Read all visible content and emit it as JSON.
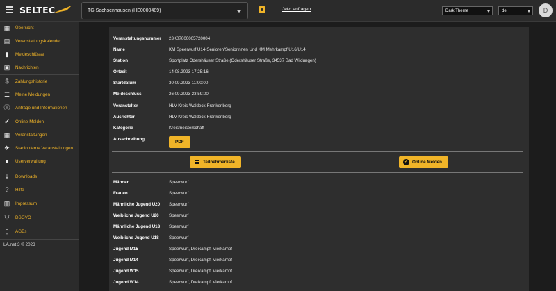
{
  "header": {
    "logo_text": "SELTEC",
    "club_select_value": "TG Sachsenhausen (HE0000489)",
    "ask_link": "Jetzt anfragen",
    "theme_value": "Dark Theme",
    "lang_value": "de",
    "avatar_initial": "D"
  },
  "colors": {
    "accent": "#f0b428",
    "background": "#1c1c1c",
    "panel": "#2e2e2e",
    "sidebar": "#2b2b2b"
  },
  "sidebar": {
    "items": [
      {
        "label": "Übersicht",
        "icon": "dashboard-icon"
      },
      {
        "label": "Veranstaltungskalender",
        "icon": "calendar-icon"
      },
      {
        "label": "Meldeschlüsse",
        "icon": "alert-icon"
      },
      {
        "label": "Nachrichten",
        "icon": "news-icon"
      },
      {
        "label": "Zahlungshistorie",
        "icon": "dollar-icon"
      },
      {
        "label": "Meine Meldungen",
        "icon": "list-icon"
      },
      {
        "label": "Anträge und Informationen",
        "icon": "info-icon"
      },
      {
        "label": "Online-Melden",
        "icon": "check-circle-icon"
      },
      {
        "label": "Veranstaltungen",
        "icon": "event-icon"
      },
      {
        "label": "Stadionferne Veranstaltungen",
        "icon": "runner-icon"
      },
      {
        "label": "Userverwaltung",
        "icon": "user-icon"
      },
      {
        "label": "Downloads",
        "icon": "download-icon"
      },
      {
        "label": "Hilfe",
        "icon": "help-icon"
      },
      {
        "label": "Impressum",
        "icon": "building-icon"
      },
      {
        "label": "DSGVO",
        "icon": "shield-icon"
      },
      {
        "label": "AGBs",
        "icon": "book-icon"
      }
    ],
    "footer": "LA.net 3 © 2023"
  },
  "details": [
    {
      "key": "Veranstaltungsnummer",
      "value": "23K07000005720004"
    },
    {
      "key": "Name",
      "value": "KM Speerwurf U14-Senioren/Seniorinnen Und KM Mehrkampf U16/U14"
    },
    {
      "key": "Station",
      "value": "Sportplatz Odershäuser Straße (Odershäuser Straße, 34537 Bad Wildungen)"
    },
    {
      "key": "Ortzeit",
      "value": "14.08.2023 17:25:16"
    },
    {
      "key": "Startdatum",
      "value": "30.09.2023 11:00:00"
    },
    {
      "key": "Meldeschluss",
      "value": "26.09.2023 23:59:00"
    },
    {
      "key": "Veranstalter",
      "value": "HLV-Kreis Waldeck-Frankenberg"
    },
    {
      "key": "Ausrichter",
      "value": "HLV-Kreis Waldeck-Frankenberg"
    },
    {
      "key": "Kategorie",
      "value": "Kreismeisterschaft"
    },
    {
      "key": "Ausschreibung",
      "value": ""
    }
  ],
  "pdf_button": "PDF",
  "buttons": {
    "participants": "Teilnehmerliste",
    "online_register": "Online Melden"
  },
  "disciplines": [
    {
      "key": "Männer",
      "value": "Speerwurf"
    },
    {
      "key": "Frauen",
      "value": "Speerwurf"
    },
    {
      "key": "Männliche Jugend U20",
      "value": "Speerwurf"
    },
    {
      "key": "Weibliche Jugend U20",
      "value": "Speerwurf"
    },
    {
      "key": "Männliche Jugend U18",
      "value": "Speerwurf"
    },
    {
      "key": "Weibliche Jugend U18",
      "value": "Speerwurf"
    },
    {
      "key": "Jugend M15",
      "value": "Speerwurf, Dreikampf, Vierkampf"
    },
    {
      "key": "Jugend M14",
      "value": "Speerwurf, Dreikampf, Vierkampf"
    },
    {
      "key": "Jugend W15",
      "value": "Speerwurf, Dreikampf, Vierkampf"
    },
    {
      "key": "Jugend W14",
      "value": "Speerwurf, Dreikampf, Vierkampf"
    }
  ]
}
